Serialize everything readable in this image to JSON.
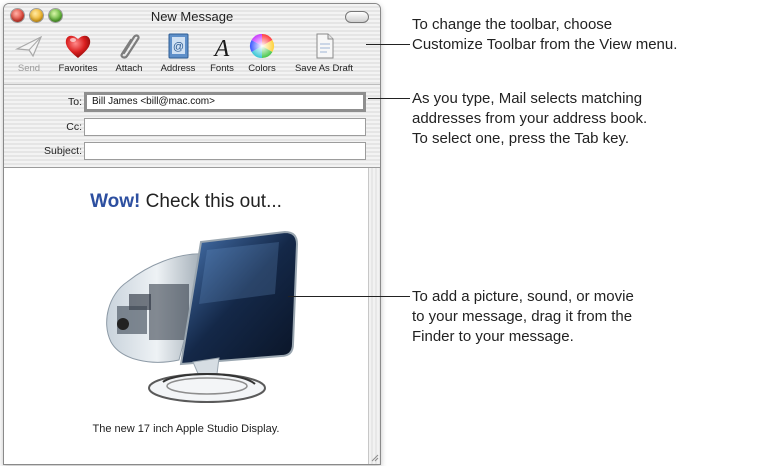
{
  "window": {
    "title": "New Message"
  },
  "toolbar": {
    "items": [
      {
        "label": "Send",
        "icon": "paper-plane-icon",
        "enabled": false
      },
      {
        "label": "Favorites",
        "icon": "heart-icon",
        "enabled": true
      },
      {
        "label": "Attach",
        "icon": "paperclip-icon",
        "enabled": true
      },
      {
        "label": "Address",
        "icon": "address-book-icon",
        "enabled": true
      },
      {
        "label": "Fonts",
        "icon": "font-A-icon",
        "enabled": true
      },
      {
        "label": "Colors",
        "icon": "color-wheel-icon",
        "enabled": true
      },
      {
        "label": "Save As Draft",
        "icon": "draft-document-icon",
        "enabled": true
      }
    ]
  },
  "headers": {
    "to_label": "To:",
    "to_value": "Bill James <bill@mac.com>",
    "cc_label": "Cc:",
    "cc_value": "",
    "subject_label": "Subject:",
    "subject_value": ""
  },
  "message": {
    "headline_accent": "Wow!",
    "headline_rest": "Check this out...",
    "image": "apple-studio-display-image",
    "caption": "The new 17 inch Apple Studio Display."
  },
  "callouts": [
    {
      "lines": [
        "To change the toolbar, choose",
        "Customize Toolbar from the View menu."
      ]
    },
    {
      "lines": [
        "As you type, Mail selects matching",
        "addresses from your address book.",
        "To select one, press the Tab key."
      ]
    },
    {
      "lines": [
        "To add a picture, sound, or movie",
        "to your message, drag it from the",
        "Finder to your message."
      ]
    }
  ],
  "colors": {
    "headline_accent": "#2d4fa0",
    "close": "#e0473a",
    "minimize": "#f1b52a",
    "zoom": "#62b53a"
  }
}
